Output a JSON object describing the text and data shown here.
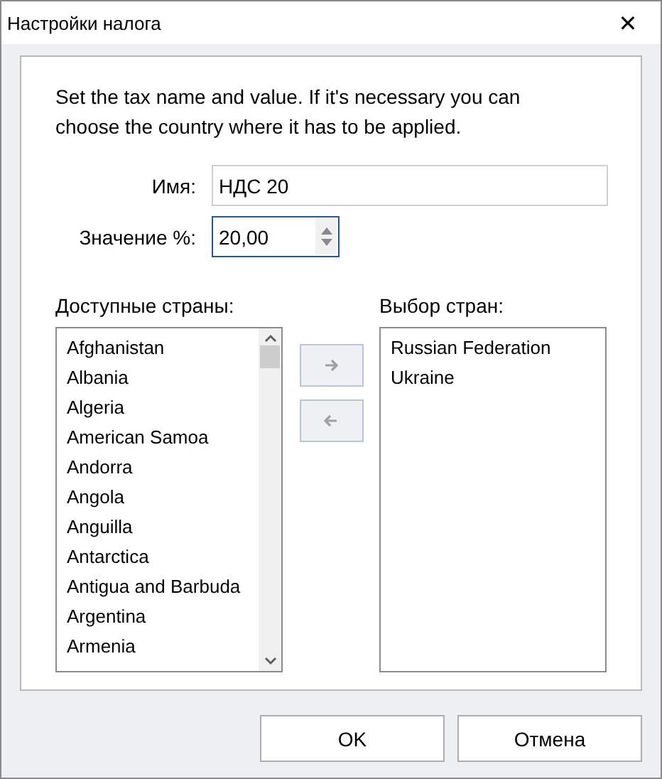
{
  "window": {
    "title": "Настройки налога",
    "close": "✕"
  },
  "description": "Set the tax name and value. If it's necessary you can choose the country where it has to be applied.",
  "fields": [
    {
      "kind": "text",
      "label": "Имя:",
      "value": "НДС 20",
      "focused": false
    },
    {
      "kind": "spin",
      "label": "Значение %:",
      "value": "20,00",
      "focused": true
    }
  ],
  "available": {
    "label": "Доступные страны:",
    "items": [
      "Afghanistan",
      "Albania",
      "Algeria",
      "American Samoa",
      "Andorra",
      "Angola",
      "Anguilla",
      "Antarctica",
      "Antigua and Barbuda",
      "Argentina",
      "Armenia"
    ]
  },
  "transfer_buttons": [
    {
      "kind": "right",
      "disabled": true
    },
    {
      "kind": "left",
      "disabled": true
    }
  ],
  "selected": {
    "label": "Выбор стран:",
    "items": [
      "Russian Federation",
      "Ukraine"
    ]
  },
  "buttons": [
    "OK",
    "Отмена"
  ]
}
